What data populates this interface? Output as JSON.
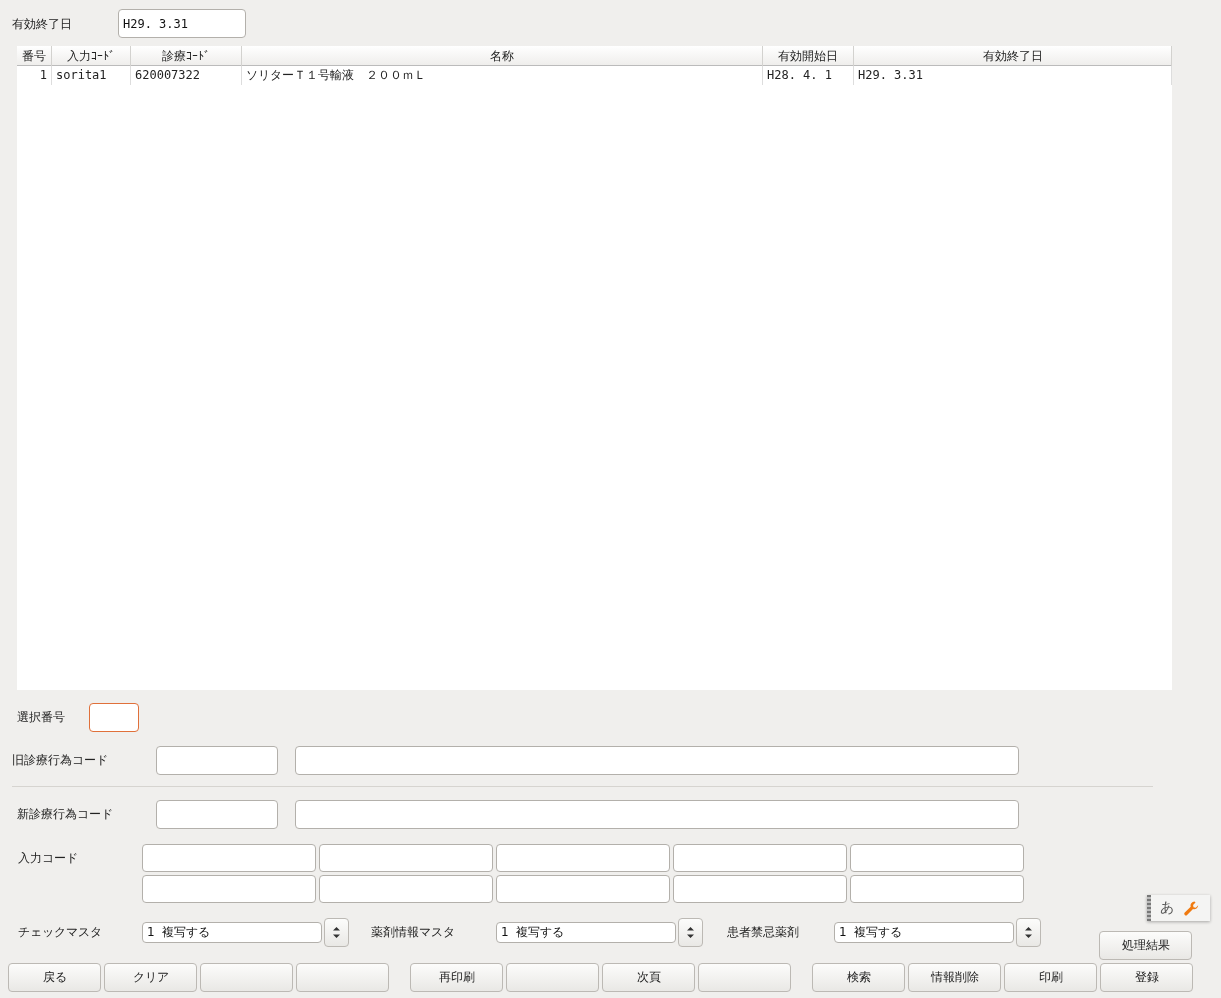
{
  "filter": {
    "label": "有効終了日",
    "value": "H29. 3.31"
  },
  "table": {
    "columns": [
      "番号",
      "入力ｺｰﾄﾞ",
      "診療ｺｰﾄﾞ",
      "名称",
      "有効開始日",
      "有効終了日"
    ],
    "rows": [
      [
        "1",
        "sorita1",
        "620007322",
        "ソリターＴ１号輸液　２００ｍＬ",
        "H28. 4. 1",
        "H29. 3.31"
      ]
    ]
  },
  "select_number": {
    "label": "選択番号",
    "focused": true
  },
  "old_code": {
    "label": "旧診療行為コード"
  },
  "new_code": {
    "label": "新診療行為コード"
  },
  "input_code": {
    "label": "入力コード"
  },
  "copy_options": [
    {
      "label": "チェックマスタ",
      "value": "1  複写する"
    },
    {
      "label": "薬剤情報マスタ",
      "value": "1  複写する"
    },
    {
      "label": "患者禁忌薬剤",
      "value": "1  複写する"
    }
  ],
  "ime": {
    "text": "あ"
  },
  "result_button": "処理結果",
  "buttons": [
    [
      {
        "kind": "label",
        "label": "戻る"
      },
      {
        "kind": "label",
        "label": "クリア"
      },
      {
        "kind": "blank"
      },
      {
        "kind": "blank"
      }
    ],
    [
      {
        "kind": "label",
        "label": "再印刷"
      },
      {
        "kind": "blank"
      },
      {
        "kind": "label",
        "label": "次頁"
      },
      {
        "kind": "blank"
      }
    ],
    [
      {
        "kind": "label",
        "label": "検索"
      },
      {
        "kind": "label",
        "label": "情報削除"
      },
      {
        "kind": "label",
        "label": "印刷"
      },
      {
        "kind": "label",
        "label": "登録"
      }
    ]
  ]
}
